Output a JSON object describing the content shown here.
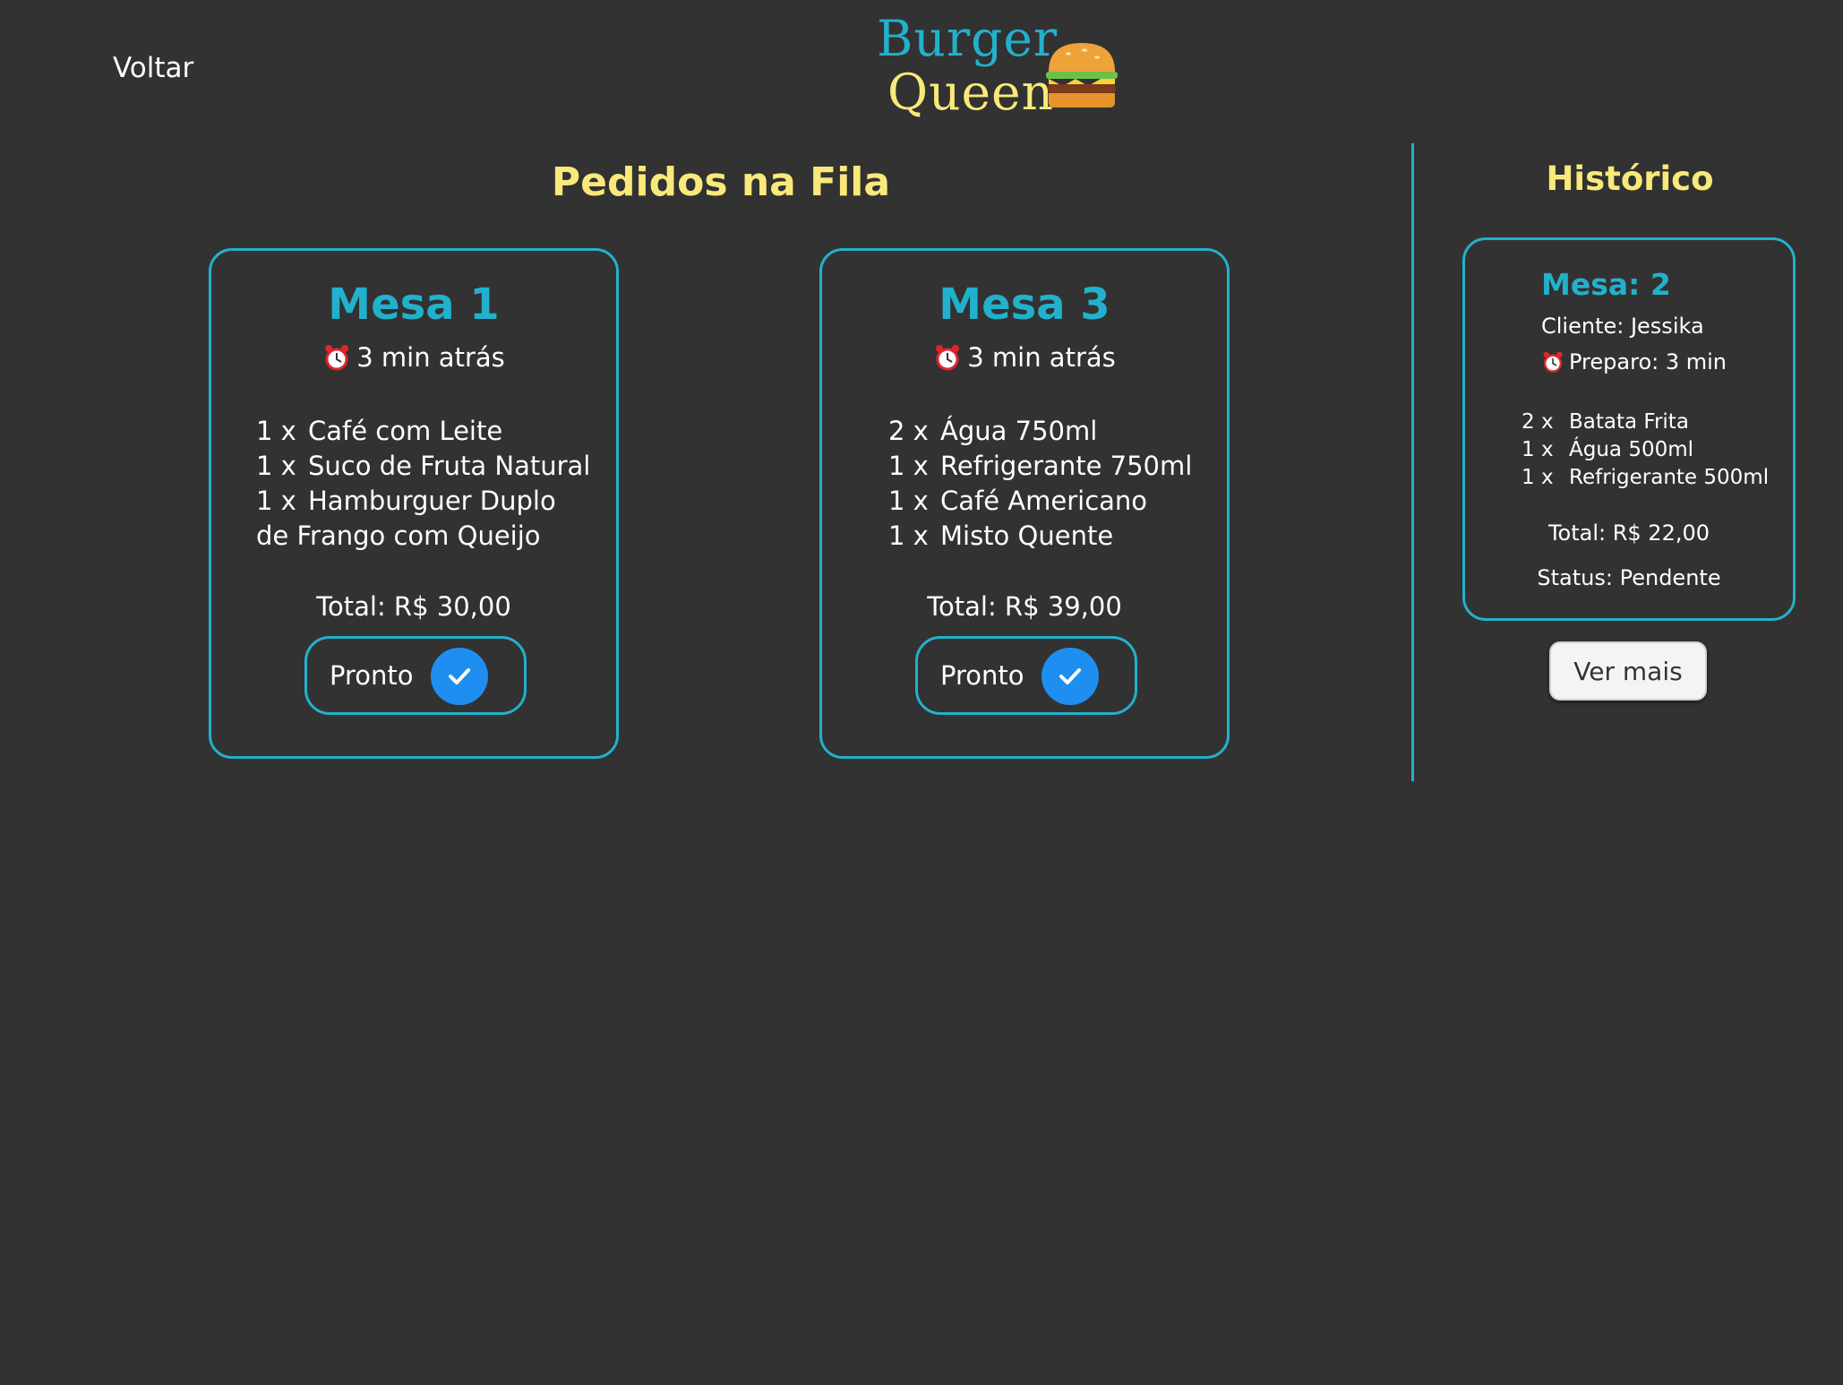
{
  "header": {
    "back_label": "Voltar",
    "logo_line1": "Burger",
    "logo_line2": "Queen"
  },
  "queue": {
    "title": "Pedidos na Fila",
    "orders": [
      {
        "mesa": "Mesa 1",
        "time": "3 min atrás",
        "items": [
          {
            "qty": "1 x",
            "name": "Café com Leite"
          },
          {
            "qty": "1 x",
            "name": "Suco de Fruta Natural"
          },
          {
            "qty": "1 x",
            "name": "Hamburguer Duplo de Frango com Queijo"
          }
        ],
        "total": "Total: R$ 30,00",
        "done_label": "Pronto"
      },
      {
        "mesa": "Mesa 3",
        "time": "3 min atrás",
        "items": [
          {
            "qty": "2 x",
            "name": "Água 750ml"
          },
          {
            "qty": "1 x",
            "name": "Refrigerante 750ml"
          },
          {
            "qty": "1 x",
            "name": "Café Americano"
          },
          {
            "qty": "1 x",
            "name": "Misto Quente"
          }
        ],
        "total": "Total: R$ 39,00",
        "done_label": "Pronto"
      }
    ]
  },
  "history": {
    "title": "Histórico",
    "card": {
      "mesa": "Mesa: 2",
      "client": "Cliente: Jessika",
      "prep": "Preparo: 3 min",
      "items": [
        {
          "qty": "2 x",
          "name": "Batata Frita"
        },
        {
          "qty": "1 x",
          "name": "Água 500ml"
        },
        {
          "qty": "1 x",
          "name": "Refrigerante 500ml"
        }
      ],
      "total": "Total: R$ 22,00",
      "status": "Status: Pendente"
    },
    "more_label": "Ver mais"
  },
  "colors": {
    "background": "#323232",
    "accent_cyan": "#22b1cc",
    "accent_yellow": "#f9e97a",
    "check_blue": "#1e8ff0"
  },
  "icons": [
    "alarm-clock-icon",
    "check-icon",
    "burger-icon"
  ]
}
